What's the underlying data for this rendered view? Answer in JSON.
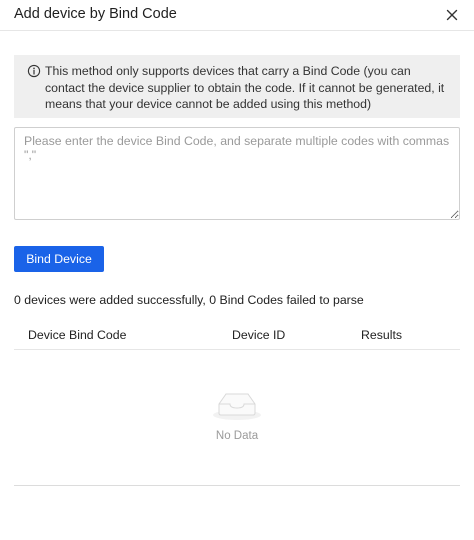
{
  "dialog": {
    "title": "Add device by Bind Code",
    "close_icon": "close-icon"
  },
  "notice": {
    "icon": "info-icon",
    "text": "This method only supports devices that carry a Bind Code (you can contact the device supplier to obtain the code. If it cannot be generated, it means that your device cannot be added using this method)"
  },
  "bind_code_input": {
    "value": "",
    "placeholder": "Please enter the device Bind Code, and separate multiple codes with commas \",\""
  },
  "bind_button": {
    "label": "Bind Device",
    "color": "#1a63e8"
  },
  "summary": "0 devices were added successfully, 0 Bind Codes failed to parse",
  "results_table": {
    "columns": [
      "Device Bind Code",
      "Device ID",
      "Results"
    ],
    "rows": [],
    "empty_icon": "empty-inbox-icon",
    "empty_text": "No Data"
  }
}
